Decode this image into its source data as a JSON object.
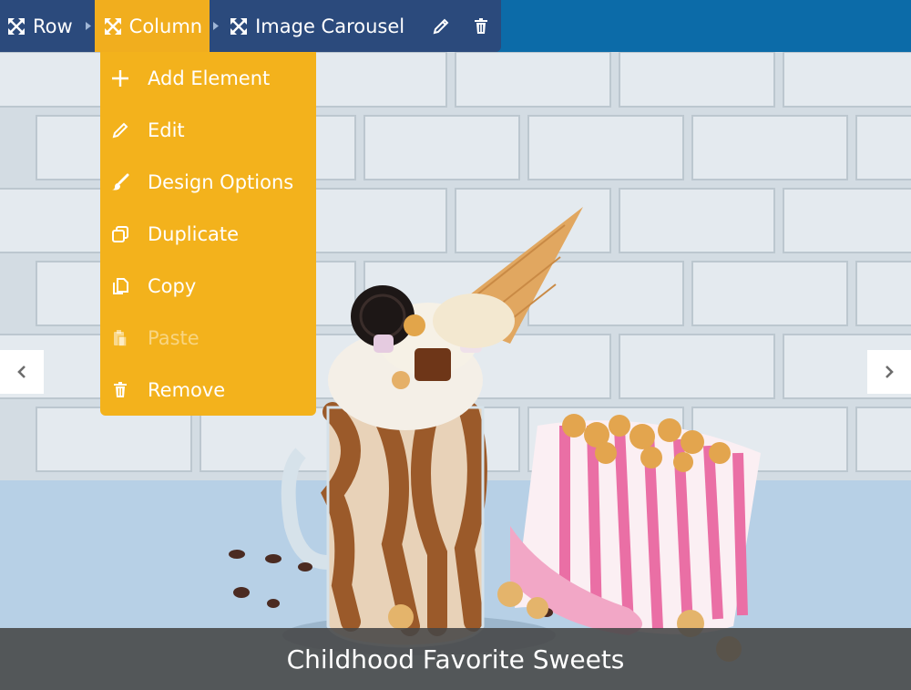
{
  "toolbar": {
    "crumbs": [
      {
        "label": "Row",
        "icon": "move-icon"
      },
      {
        "label": "Column",
        "icon": "move-icon",
        "active": true
      },
      {
        "label": "Image Carousel",
        "icon": "move-icon"
      }
    ],
    "tools": [
      {
        "icon": "pencil-icon"
      },
      {
        "icon": "trash-icon"
      }
    ],
    "colors": {
      "bar": "#0c6ba8",
      "crumbs": "#2b4a7c",
      "accent": "#f1ae1e"
    }
  },
  "menu": {
    "items": [
      {
        "label": "Add Element",
        "icon": "plus-icon"
      },
      {
        "label": "Edit",
        "icon": "pencil-icon"
      },
      {
        "label": "Design Options",
        "icon": "paintbrush-icon"
      },
      {
        "label": "Duplicate",
        "icon": "duplicate-icon"
      },
      {
        "label": "Copy",
        "icon": "copy-icon"
      },
      {
        "label": "Paste",
        "icon": "paste-icon",
        "disabled": true
      },
      {
        "label": "Remove",
        "icon": "trash-icon"
      }
    ]
  },
  "carousel": {
    "caption": "Childhood Favorite Sweets",
    "prev_icon": "chevron-left-icon",
    "next_icon": "chevron-right-icon"
  }
}
